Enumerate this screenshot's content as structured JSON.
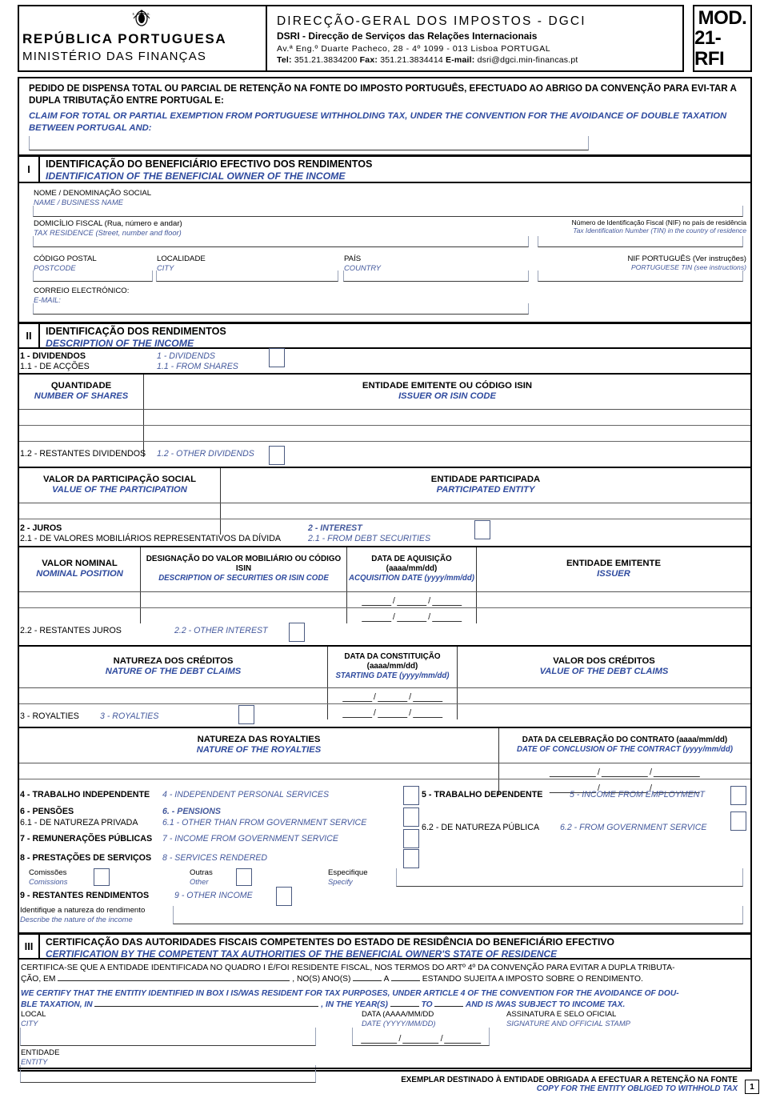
{
  "header": {
    "republic": "REPÚBLICA PORTUGUESA",
    "ministry": "MINISTÉRIO DAS FINANÇAS",
    "directorate": "DIRECÇÃO-GERAL  DOS  IMPOSTOS  -  DGCI",
    "service": "DSRI - Direcção  de Serviços das Relações Internacionais",
    "address": "Av.ª Eng.º Duarte Pacheco, 28 - 4º        1099 - 013   Lisboa PORTUGAL",
    "contact_tel_label": "Tel:",
    "contact_tel": "351.21.3834200",
    "contact_fax_label": "Fax:",
    "contact_fax": "351.21.3834414",
    "contact_email_label": "E-mail:",
    "contact_email": "dsri@dgci.min-financas.pt",
    "form_mod": "MOD.",
    "form_code": "21-RFI"
  },
  "intro": {
    "pt": "PEDIDO DE DISPENSA TOTAL OU PARCIAL DE RETENÇÃO NA FONTE DO IMPOSTO PORTUGUÊS, EFECTUADO AO ABRIGO DA CONVENÇÃO PARA EVI-TAR A DUPLA TRIBUTAÇÃO ENTRE PORTUGAL E:",
    "en": "CLAIM FOR TOTAL OR PARTIAL EXEMPTION FROM PORTUGUESE WITHHOLDING TAX, UNDER  THE CONVENTION FOR THE AVOIDANCE OF DOUBLE TAXATION BETWEEN PORTUGAL AND:"
  },
  "section1": {
    "number": "I",
    "title_pt": "IDENTIFICAÇÃO DO BENEFICIÁRIO EFECTIVO DOS RENDIMENTOS",
    "title_en": "IDENTIFICATION OF THE BENEFICIAL OWNER OF THE INCOME",
    "fields": {
      "name_pt": "NOME / DENOMINAÇÃO SOCIAL",
      "name_en": "NAME / BUSINESS NAME",
      "residence_pt": "DOMICÍLIO FISCAL (Rua, número e andar)",
      "residence_en": "TAX RESIDENCE (Street, number and floor)",
      "tin_pt": "Número de Identificação Fiscal (NIF) no país de residência",
      "tin_en": "Tax Identification Number (TIN) in the country of residence",
      "postcode_pt": "CÓDIGO POSTAL",
      "postcode_en": "POSTCODE",
      "city_pt": "LOCALIDADE",
      "city_en": "CITY",
      "country_pt": "PAÍS",
      "country_en": "COUNTRY",
      "ptin_pt": "NIF PORTUGUÊS (Ver instruções)",
      "ptin_en": "PORTUGUESE TIN (see instructions)",
      "email_pt": "CORREIO ELECTRÓNICO:",
      "email_en": "E-MAIL:"
    }
  },
  "section2": {
    "number": "II",
    "title_pt": "IDENTIFICAÇÃO DOS RENDIMENTOS",
    "title_en": "DESCRIPTION OF THE INCOME",
    "item1": {
      "pt_line1": "1 - DIVIDENDOS",
      "pt_line2": "1.1 - DE ACÇÕES",
      "en_line1": "1 - DIVIDENDS",
      "en_line2": "1.1 - FROM SHARES"
    },
    "table1": {
      "headers": [
        {
          "pt": "QUANTIDADE",
          "en": "NUMBER OF SHARES"
        },
        {
          "pt": "ENTIDADE EMITENTE OU CÓDIGO ISIN",
          "en": "ISSUER OR ISIN CODE"
        }
      ],
      "rows": [
        [
          "",
          ""
        ],
        [
          "",
          ""
        ],
        [
          "",
          ""
        ]
      ]
    },
    "item12": {
      "pt": "1.2 - RESTANTES DIVIDENDOS",
      "en": "1.2 - OTHER DIVIDENDS"
    },
    "table2": {
      "headers": [
        {
          "pt": "VALOR DA PARTICIPAÇÃO SOCIAL",
          "en": "VALUE OF THE PARTICIPATION"
        },
        {
          "pt": "ENTIDADE PARTICIPADA",
          "en": "PARTICIPATED ENTITY"
        }
      ],
      "rows": [
        [
          "",
          ""
        ],
        [
          "",
          ""
        ]
      ]
    },
    "item2": {
      "pt_line1": "2 - JUROS",
      "pt_line2": "2.1 - DE VALORES MOBILIÁRIOS REPRESENTATIVOS DA DÍVIDA",
      "en_line1": "2 - INTEREST",
      "en_line2": "2.1 - FROM DEBT SECURITIES"
    },
    "table3": {
      "headers": [
        {
          "pt": "VALOR NOMINAL",
          "en": "NOMINAL POSITION"
        },
        {
          "pt": "DESIGNAÇÃO DO VALOR MOBILIÁRIO OU CÓDIGO ISIN",
          "en": "DESCRIPTION OF SECURITIES OR ISIN CODE"
        },
        {
          "pt": "DATA DE AQUISIÇÃO (aaaa/mm/dd)",
          "en": "ACQUISITION DATE (yyyy/mm/dd)"
        },
        {
          "pt": "ENTIDADE EMITENTE",
          "en": "ISSUER"
        }
      ],
      "rows": [
        [
          "",
          "",
          "",
          ""
        ],
        [
          "",
          "",
          "",
          ""
        ]
      ]
    },
    "item22": {
      "pt": "2.2 - RESTANTES JUROS",
      "en": "2.2 - OTHER INTEREST"
    },
    "table4": {
      "headers": [
        {
          "pt": "NATUREZA DOS CRÉDITOS",
          "en": "NATURE OF THE DEBT CLAIMS"
        },
        {
          "pt": "DATA DA CONSTITUIÇÃO (aaaa/mm/dd)",
          "en": "STARTING DATE (yyyy/mm/dd)"
        },
        {
          "pt": "VALOR DOS CRÉDITOS",
          "en": "VALUE OF THE DEBT CLAIMS"
        }
      ],
      "rows": [
        [
          "",
          "",
          ""
        ],
        [
          "",
          "",
          ""
        ]
      ]
    },
    "item3": {
      "pt": "3 - ROYALTIES",
      "en": "3 - ROYALTIES"
    },
    "table5": {
      "headers": [
        {
          "pt": "NATUREZA DAS ROYALTIES",
          "en": "NATURE OF THE ROYALTIES"
        },
        {
          "pt": "DATA DA CELEBRAÇÃO DO CONTRATO (aaaa/mm/dd)",
          "en": "DATE OF CONCLUSION OF THE CONTRACT (yyyy/mm/dd)"
        }
      ],
      "rows": [
        [
          "",
          ""
        ],
        [
          "",
          ""
        ]
      ]
    },
    "items": [
      {
        "num": "4",
        "pt": "4 - TRABALHO INDEPENDENTE",
        "en": "4 - INDEPENDENT PERSONAL SERVICES"
      },
      {
        "num": "5",
        "pt": "5 - TRABALHO DEPENDENTE",
        "en": "5 - INCOME FROM EMPLOYMENT"
      },
      {
        "num": "6",
        "pt": "6 - PENSÕES",
        "en": "6. - PENSIONS"
      },
      {
        "num": "6.1",
        "pt": "6.1 - DE NATUREZA PRIVADA",
        "en": "6.1 - OTHER THAN FROM GOVERNMENT SERVICE"
      },
      {
        "num": "6.2",
        "pt": "6.2 - DE NATUREZA PÚBLICA",
        "en": "6.2 - FROM GOVERNMENT SERVICE"
      },
      {
        "num": "7",
        "pt": "7 - REMUNERAÇÕES PÚBLICAS",
        "en": "7 - INCOME FROM GOVERNMENT SERVICE"
      },
      {
        "num": "8",
        "pt": "8 - PRESTAÇÕES DE SERVIÇOS",
        "en": "8 - SERVICES RENDERED"
      },
      {
        "num": "9",
        "pt": "9 - RESTANTES RENDIMENTOS",
        "en": "9 - OTHER INCOME"
      }
    ],
    "sub8": {
      "commissions_pt": "Comissões",
      "commissions_en": "Comissions",
      "other_pt": "Outras",
      "other_en": "Other",
      "specify_pt": "Especifique",
      "specify_en": "Specify"
    },
    "sub9": {
      "pt": "Identifique a natureza do rendimento",
      "en": "Describe the nature of the income"
    }
  },
  "section3": {
    "number": "III",
    "title_pt": "CERTIFICAÇÃO DAS AUTORIDADES FISCAIS COMPETENTES DO ESTADO DE RESIDÊNCIA DO BENEFICIÁRIO EFECTIVO",
    "title_en": "CERTIFICATION BY THE COMPETENT TAX AUTHORITIES OF THE BENEFICIAL OWNER'S STATE OF RESIDENCE",
    "pt_a": "CERTIFICA-SE QUE A ENTIDADE IDENTIFICADA NO QUADRO I É/FOI RESIDENTE FISCAL, NOS TERMOS DO ARTº 4º DA CONVENÇÃO PARA EVITAR A DUPLA TRIBUTA-",
    "pt_b1": "ÇÃO, EM",
    "pt_b2": ", NO(S) ANO(S)",
    "pt_b3": "A",
    "pt_b4": "ESTANDO SUJEITA A IMPOSTO SOBRE O RENDIMENTO.",
    "en_a": "WE CERTIFY THAT THE ENTITIY IDENTIFIED IN BOX I IS/WAS RESIDENT FOR TAX PURPOSES, UNDER ARTICLE 4 OF THE CONVENTION FOR THE AVOIDANCE OF DOU-",
    "en_b1": "BLE TAXATION, IN",
    "en_b2": ", IN THE YEAR(S)",
    "en_b3": "TO",
    "en_b4": "AND IS /WAS SUBJECT TO INCOME TAX.",
    "local_pt": "LOCAL",
    "local_en": "CITY",
    "date_pt": "DATA (AAAA/MM/DD",
    "date_en": "DATE (YYYY/MM/DD)",
    "sign_pt": "ASSINATURA E SELO OFICIAL",
    "sign_en": "SIGNATURE AND OFFICIAL STAMP",
    "entity_pt": "ENTIDADE",
    "entity_en": "ENTITY"
  },
  "footer": {
    "pt": "EXEMPLAR DESTINADO À ENTIDADE OBRIGADA A EFECTUAR A RETENÇÃO NA FONTE",
    "en": "COPY FOR THE ENTITY OBLIGED TO WITHHOLD TAX",
    "page": "1"
  }
}
